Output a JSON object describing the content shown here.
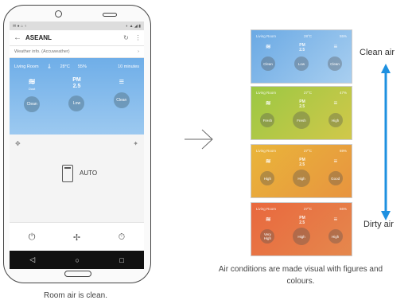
{
  "phone": {
    "app_title": "ASEANL",
    "weather_info": "Weather info. (Accuweather)",
    "room": "Living Room",
    "temperature": "28°C",
    "humidity": "55%",
    "updated": "10 minutes",
    "metrics": [
      {
        "glyph": "≋",
        "label": "Dust",
        "level": "Clean"
      },
      {
        "glyph": "PM 2.5",
        "label": "",
        "level": "Low"
      },
      {
        "glyph": "≡",
        "label": "",
        "level": "Clean"
      }
    ],
    "mode": "AUTO"
  },
  "caption": "Room air is clean.",
  "cards": [
    {
      "color": "blue",
      "hdr_room": "Living Room",
      "hdr_temp": "28°C",
      "hdr_hum": "55%",
      "levels": [
        "Clean",
        "Low",
        "Clean"
      ]
    },
    {
      "color": "green",
      "hdr_room": "Living Room",
      "hdr_temp": "27°C",
      "hdr_hum": "47%",
      "levels": [
        "Fresh",
        "Fresh",
        "High"
      ]
    },
    {
      "color": "yellow",
      "hdr_room": "Living Room",
      "hdr_temp": "27°C",
      "hdr_hum": "69%",
      "levels": [
        "High",
        "High",
        "Good"
      ]
    },
    {
      "color": "red",
      "hdr_room": "Living Room",
      "hdr_temp": "27°C",
      "hdr_hum": "66%",
      "levels": [
        "Very High",
        "High",
        "High"
      ]
    }
  ],
  "labels": {
    "clean_air": "Clean air",
    "dirty_air": "Dirty air",
    "note": "Air conditions are made visual with figures and colours."
  },
  "colors": {
    "scale_arrow": "#1e90e0"
  }
}
